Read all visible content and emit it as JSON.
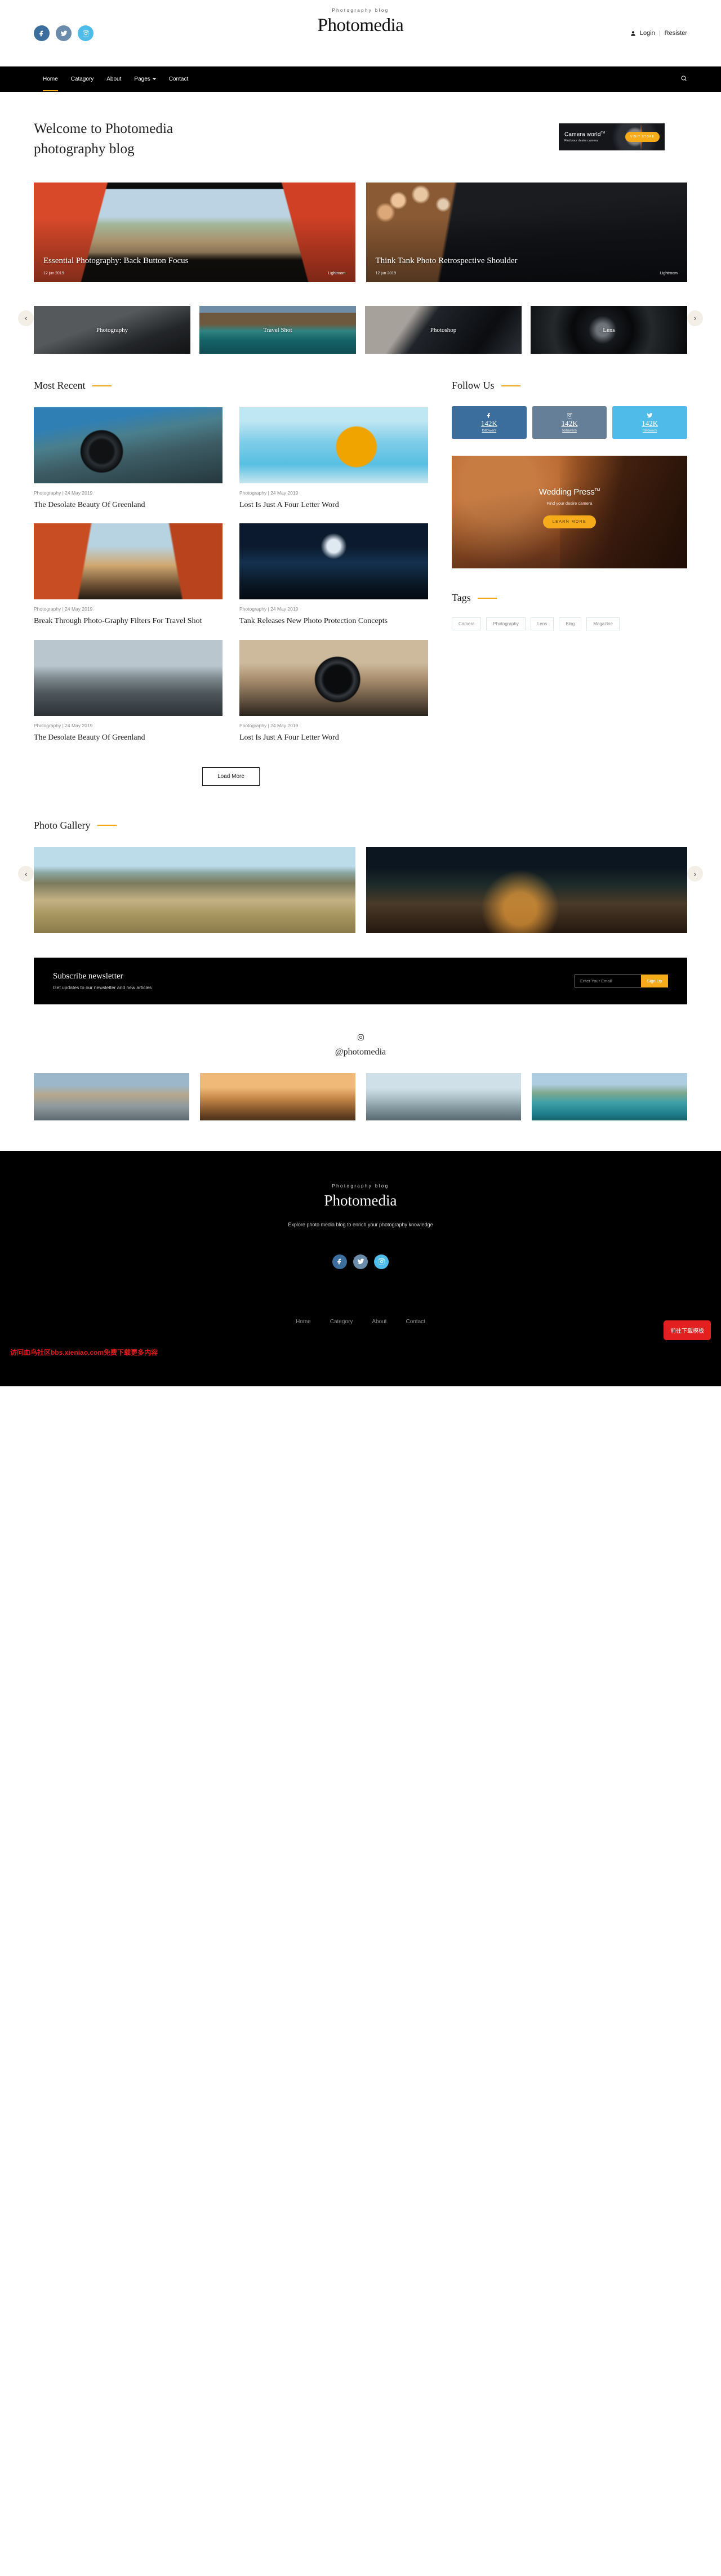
{
  "header": {
    "brand_sub": "Photography blog",
    "brand_title": "Photomedia",
    "login": "Login",
    "separator": "|",
    "register": "Resister",
    "social": [
      {
        "name": "facebook",
        "glyph": "f"
      },
      {
        "name": "twitter",
        "glyph": "t"
      },
      {
        "name": "instagram",
        "glyph": "i"
      }
    ]
  },
  "nav": {
    "items": [
      {
        "label": "Home",
        "active": true,
        "caret": false
      },
      {
        "label": "Catagory",
        "active": false,
        "caret": false
      },
      {
        "label": "About",
        "active": false,
        "caret": false
      },
      {
        "label": "Pages",
        "active": false,
        "caret": true
      },
      {
        "label": "Contact",
        "active": false,
        "caret": false
      }
    ],
    "search_icon": "search-icon"
  },
  "hero": {
    "title": "Welcome to Photomedia photography blog",
    "ad": {
      "title": "Camera world",
      "tm": "TM",
      "subtitle": "Find your desire camera",
      "button": "VISIT STORE"
    }
  },
  "features": [
    {
      "title": "Essential Photography: Back Button Focus",
      "date": "12 jun 2019",
      "tag": "Lightroom"
    },
    {
      "title": "Think Tank Photo Retrospective Shoulder",
      "date": "12 jun 2019",
      "tag": "Lightroom"
    }
  ],
  "categories": {
    "prev": "‹",
    "next": "›",
    "items": [
      {
        "label": "Photography"
      },
      {
        "label": "Travel Shot"
      },
      {
        "label": "Photoshop"
      },
      {
        "label": "Lens"
      }
    ]
  },
  "most_recent": {
    "heading": "Most Recent",
    "posts": [
      {
        "meta": "Photography | 24 May 2019",
        "title": "The Desolate Beauty Of Greenland"
      },
      {
        "meta": "Photography | 24 May 2019",
        "title": "Lost Is Just A Four Letter Word"
      },
      {
        "meta": "Photography | 24 May 2019",
        "title": "Break Through Photo-Graphy Filters For Travel Shot"
      },
      {
        "meta": "Photography | 24 May 2019",
        "title": "Tank Releases New Photo Protection Concepts"
      },
      {
        "meta": "Photography | 24 May 2019",
        "title": "The Desolate Beauty Of Greenland"
      },
      {
        "meta": "Photography | 24 May 2019",
        "title": "Lost Is Just A Four Letter Word"
      }
    ],
    "load_more": "Load More"
  },
  "sidebar": {
    "follow_heading": "Follow Us",
    "follow": [
      {
        "network": "facebook",
        "count": "142K",
        "label": "followers",
        "color": "#3b6e9c"
      },
      {
        "network": "instagram",
        "count": "142K",
        "label": "followers",
        "color": "#667f99"
      },
      {
        "network": "twitter",
        "count": "142K",
        "label": "followers",
        "color": "#4fbbe8"
      }
    ],
    "ad": {
      "title": "Wedding Press",
      "tm": "TM",
      "subtitle": "Find your desire camera",
      "button": "LEARN MORE"
    },
    "tags_heading": "Tags",
    "tags": [
      "Camera",
      "Photography",
      "Lens",
      "Blog",
      "Magazine"
    ]
  },
  "gallery": {
    "heading": "Photo Gallery",
    "prev": "‹",
    "next": "›"
  },
  "newsletter": {
    "title": "Subscribe newsletter",
    "subtitle": "Get updates to our newsletter and new articles",
    "placeholder": "Enter Your Email",
    "value": "",
    "button": "Sign Up"
  },
  "instagram": {
    "handle": "@photomedia"
  },
  "footer": {
    "brand_sub": "Photography blog",
    "brand_title": "Photomedia",
    "description": "Explore photo media blog to enrich your photography knowledge",
    "nav": [
      "Home",
      "Category",
      "About",
      "Contact"
    ],
    "watermark": "访问血鸟社区bbs.xieniao.com免费下载更多内容",
    "download_button": "前往下载模板"
  },
  "colors": {
    "accent": "#f0a916",
    "dark": "#000000",
    "facebook": "#3b6e9c",
    "twitter": "#6b8bab",
    "instagram": "#4fbbe8"
  }
}
